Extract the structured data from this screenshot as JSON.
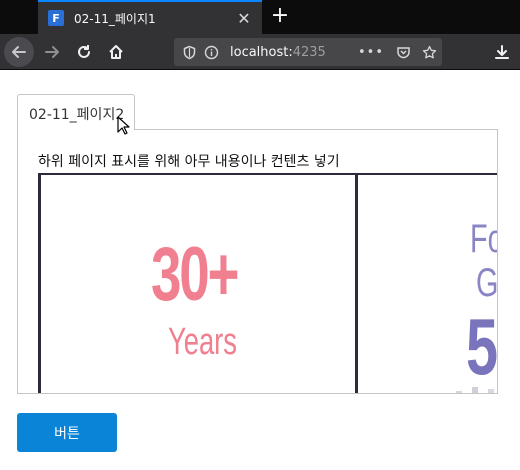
{
  "browser": {
    "tab_title": "02-11_페이지1",
    "favicon_letter": "F",
    "new_tab_symbol": "+",
    "close_symbol": "✕",
    "url_host": "localhost:",
    "url_port": "4235",
    "url_more": "•••"
  },
  "page": {
    "tab_label": "02-11_페이지2",
    "panel_text": "하위 페이지 표시를 위해 아무 내용이나 컨텐츠 넣기",
    "banner": {
      "card1_number": "30+",
      "card1_caption": "Years",
      "card2_line1": "Fo",
      "card2_line2": "G",
      "card2_number": "5"
    },
    "button_label": "버튼"
  },
  "colors": {
    "accent": "#0a84d6",
    "banner_pink": "#f0808f",
    "banner_purple": "#8a86c6"
  }
}
